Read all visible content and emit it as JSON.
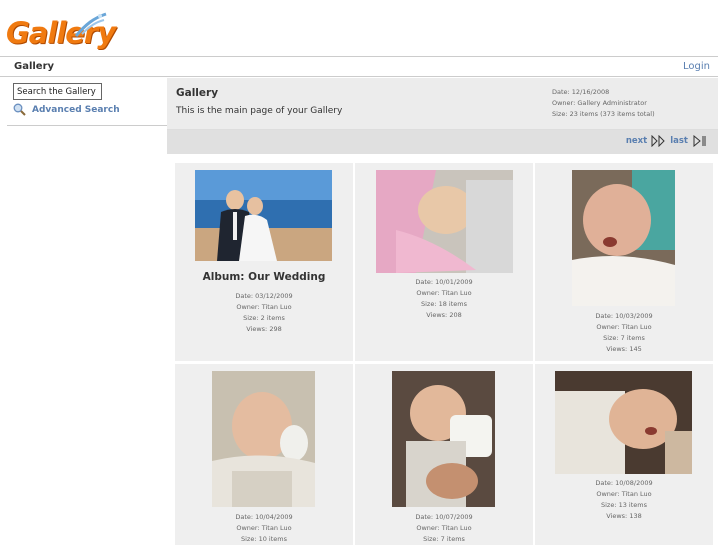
{
  "logo": {
    "text": "Gallery"
  },
  "topbar": {
    "breadcrumb": "Gallery",
    "login": "Login"
  },
  "sidebar": {
    "search_placeholder": "Search the Gallery",
    "advanced_search": "Advanced Search"
  },
  "header": {
    "title": "Gallery",
    "description": "This is the main page of your Gallery",
    "date": "Date: 12/16/2008",
    "owner": "Owner: Gallery Administrator",
    "size": "Size: 23 items (373 items total)"
  },
  "pager": {
    "next": "next",
    "last": "last"
  },
  "items": [
    {
      "album_title": "Album: Our Wedding",
      "date": "Date: 03/12/2009",
      "owner": "Owner: Titan Luo",
      "size": "Size: 2 items",
      "views": "Views: 298"
    },
    {
      "album_title": "",
      "date": "Date: 10/01/2009",
      "owner": "Owner: Titan Luo",
      "size": "Size: 18 items",
      "views": "Views: 208"
    },
    {
      "album_title": "",
      "date": "Date: 10/03/2009",
      "owner": "Owner: Titan Luo",
      "size": "Size: 7 items",
      "views": "Views: 145"
    },
    {
      "album_title": "",
      "date": "Date: 10/04/2009",
      "owner": "Owner: Titan Luo",
      "size": "Size: 10 items",
      "views": ""
    },
    {
      "album_title": "",
      "date": "Date: 10/07/2009",
      "owner": "Owner: Titan Luo",
      "size": "Size: 7 items",
      "views": ""
    },
    {
      "album_title": "",
      "date": "Date: 10/08/2009",
      "owner": "Owner: Titan Luo",
      "size": "Size: 13 items",
      "views": "Views: 138"
    }
  ],
  "colors": {
    "link": "#5a7fb0",
    "logo": "#f07a10",
    "header_bg": "#ececec",
    "cell_bg": "#efefef"
  }
}
